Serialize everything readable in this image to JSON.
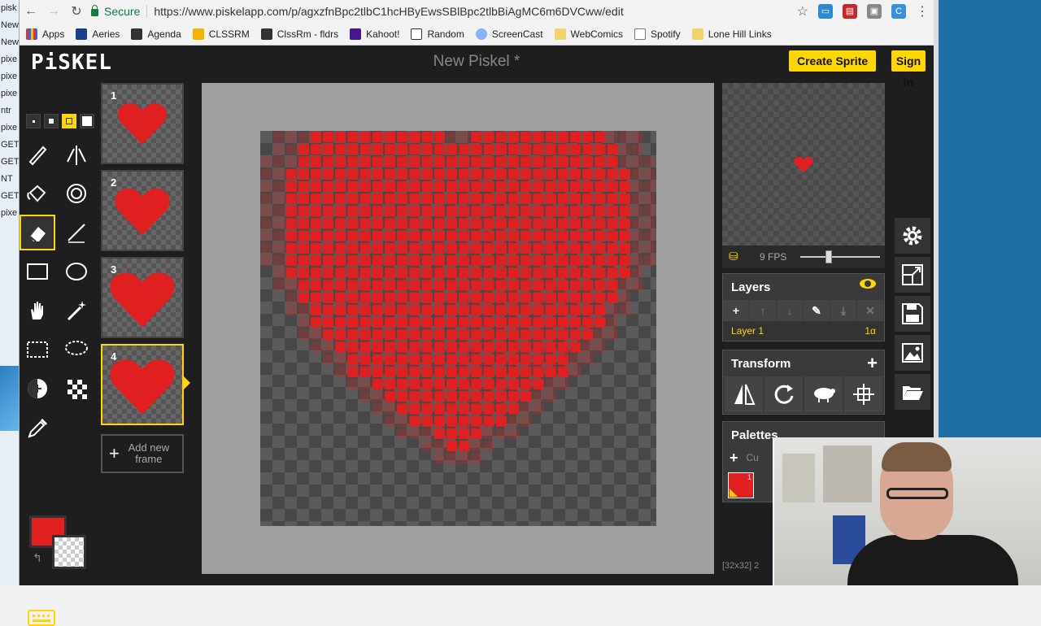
{
  "left_strip": {
    "lines": [
      "pisk",
      "New",
      "New",
      "pixe",
      "pixe",
      "pixe",
      "ntr",
      "pixe",
      "GET",
      "GET",
      "NT",
      "GET",
      "pixe"
    ]
  },
  "browser": {
    "secure_label": "Secure",
    "url": "https://www.piskelapp.com/p/agxzfnBpc2tlbC1hcHByEwsSBlBpc2tlbBiAgMC6m6DVCww/edit",
    "bookmarks": [
      "Apps",
      "Aeries",
      "Agenda",
      "CLSSRM",
      "ClssRm - fldrs",
      "Kahoot!",
      "Random",
      "ScreenCast",
      "WebComics",
      "Spotify",
      "Lone Hill Links"
    ]
  },
  "app": {
    "logo": "PiSKEL",
    "title": "New Piskel *",
    "create_sprite": "Create Sprite",
    "sign_in": "Sign in"
  },
  "frames": [
    {
      "number": "1"
    },
    {
      "number": "2"
    },
    {
      "number": "3"
    },
    {
      "number": "4"
    }
  ],
  "add_frame_label": "Add new frame",
  "colors": {
    "primary": "#e02020",
    "accent": "#ffd700"
  },
  "preview": {
    "fps_label": "9 FPS",
    "fps": 9
  },
  "layers": {
    "title": "Layers",
    "layer_name": "Layer 1",
    "layer_alpha": "1α"
  },
  "transform": {
    "title": "Transform"
  },
  "palettes": {
    "title": "Palettes",
    "palette_name": "Cu",
    "swatch_index": "1"
  },
  "coords": "[32x32]  2"
}
